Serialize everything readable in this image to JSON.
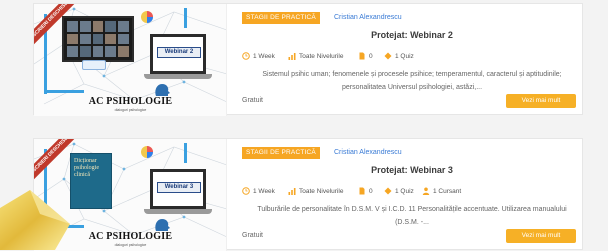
{
  "courses": [
    {
      "thumb": {
        "ribbon": "ÎNSCRIERI DESCHISE",
        "webinar_label": "Webinar 2",
        "brand": "AC PSIHOLOGIE",
        "brand_sub": "dialoguri psihologice",
        "book_title": ""
      },
      "tag": "STAGII DE PRACTICĂ",
      "author": "Cristian Alexandrescu",
      "title": "Protejat: Webinar 2",
      "meta": {
        "duration": "1 Week",
        "level": "Toate Nivelurile",
        "lessons": "0",
        "quiz": "1 Quiz",
        "students": ""
      },
      "description": "Sistemul psihic uman; fenomenele și procesele psihice; temperamentul, caracterul și aptitudinile; personalitatea Universul psihologiei, astăzi,...",
      "price": "Gratuit",
      "button": "Vezi mai mult"
    },
    {
      "thumb": {
        "ribbon": "ÎNSCRIERI DESCHISE",
        "webinar_label": "Webinar 3",
        "brand": "AC PSIHOLOGIE",
        "brand_sub": "dialoguri psihologice",
        "book_title": "Dicționar psihologie clinică"
      },
      "tag": "STAGII DE PRACTICĂ",
      "author": "Cristian Alexandrescu",
      "title": "Protejat: Webinar 3",
      "meta": {
        "duration": "1 Week",
        "level": "Toate Nivelurile",
        "lessons": "0",
        "quiz": "1 Quiz",
        "students": "1 Cursant"
      },
      "description": "Tulburările de personalitate în D.S.M. V și I.C.D. 11 Personalitățile accentuate. Utilizarea manualului (D.S.M. -...",
      "price": "Gratuit",
      "button": "Vezi mai mult"
    }
  ],
  "colors": {
    "accent": "#f6a623",
    "button": "#f6b026",
    "author_link": "#3a7bd5",
    "ribbon": "#c0392b"
  },
  "icons": [
    "clock-icon",
    "level-bars-icon",
    "lessons-file-icon",
    "quiz-icon",
    "students-icon"
  ]
}
